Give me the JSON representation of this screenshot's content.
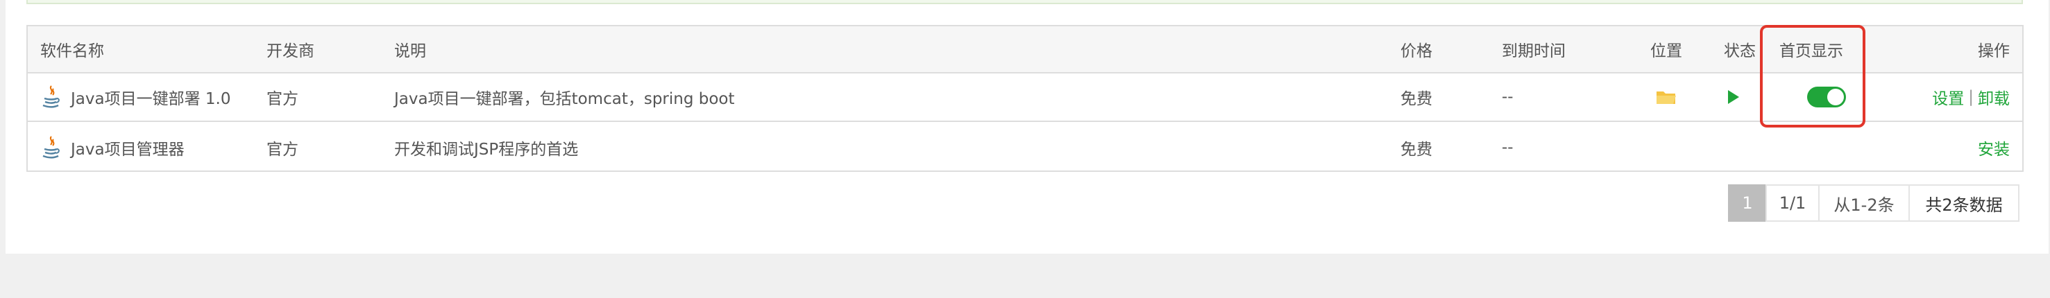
{
  "columns": {
    "name": "软件名称",
    "developer": "开发商",
    "description": "说明",
    "price": "价格",
    "expiry": "到期时间",
    "location": "位置",
    "status": "状态",
    "homepage_display": "首页显示",
    "actions": "操作"
  },
  "rows": [
    {
      "name": "Java项目一键部署 1.0",
      "developer": "官方",
      "description": "Java项目一键部署，包括tomcat，spring boot",
      "price": "免费",
      "expiry": "--",
      "location_icon": "folder-icon",
      "status_icon": "play-icon",
      "homepage_display_on": true,
      "actions": [
        "设置",
        "卸载"
      ],
      "action_separator": "|"
    },
    {
      "name": "Java项目管理器",
      "developer": "官方",
      "description": "开发和调试JSP程序的首选",
      "price": "免费",
      "expiry": "--",
      "actions": [
        "安装"
      ]
    }
  ],
  "pagination": {
    "current": "1",
    "pages": "1/1",
    "range": "从1-2条",
    "total": "共2条数据"
  },
  "colors": {
    "accent_green": "#20a53a",
    "highlight_red": "#e2362b",
    "folder_yellow": "#f5c342"
  }
}
